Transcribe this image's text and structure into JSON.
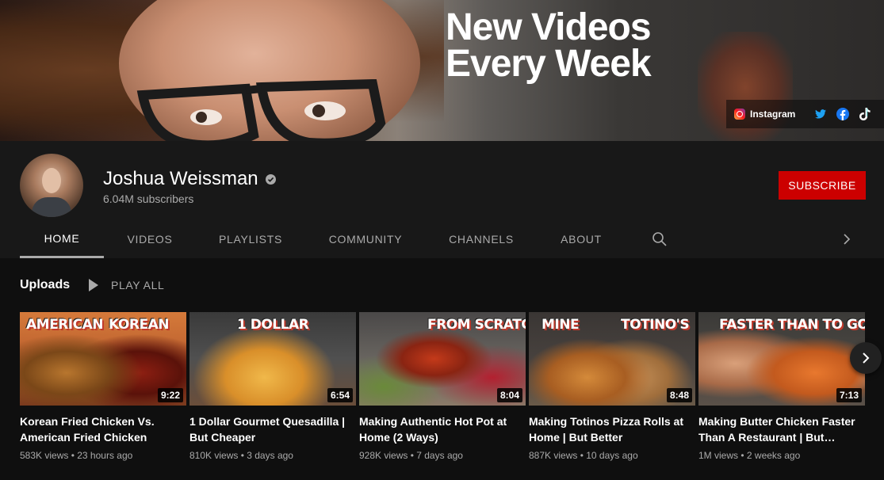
{
  "banner": {
    "title_line1": "New Videos",
    "title_line2": "Every Week",
    "links": {
      "instagram_label": "Instagram",
      "icons": [
        "instagram-icon",
        "twitter-icon",
        "facebook-icon",
        "tiktok-icon"
      ]
    }
  },
  "channel": {
    "name": "Joshua Weissman",
    "subscribers": "6.04M subscribers",
    "subscribe_label": "SUBSCRIBE"
  },
  "tabs": [
    {
      "label": "HOME",
      "active": true
    },
    {
      "label": "VIDEOS",
      "active": false
    },
    {
      "label": "PLAYLISTS",
      "active": false
    },
    {
      "label": "COMMUNITY",
      "active": false
    },
    {
      "label": "CHANNELS",
      "active": false
    },
    {
      "label": "ABOUT",
      "active": false
    }
  ],
  "uploads": {
    "title": "Uploads",
    "play_all_label": "PLAY ALL",
    "videos": [
      {
        "title": "Korean Fried Chicken Vs. American Fried Chicken",
        "duration": "9:22",
        "views": "583K views",
        "age": "23 hours ago",
        "thumb_text_left": "AMERICAN",
        "thumb_text_right": "KOREAN"
      },
      {
        "title": "1 Dollar Gourmet Quesadilla | But Cheaper",
        "duration": "6:54",
        "views": "810K views",
        "age": "3 days ago",
        "thumb_text_left": "1 DOLLAR",
        "thumb_text_right": ""
      },
      {
        "title": "Making Authentic Hot Pot at Home (2 Ways)",
        "duration": "8:04",
        "views": "928K views",
        "age": "7 days ago",
        "thumb_text_left": "",
        "thumb_text_right": "FROM SCRATCH"
      },
      {
        "title": "Making Totinos Pizza Rolls at Home | But Better",
        "duration": "8:48",
        "views": "887K views",
        "age": "10 days ago",
        "thumb_text_left": "MINE",
        "thumb_text_right": "TOTINO'S"
      },
      {
        "title": "Making Butter Chicken Faster Than A Restaurant | But…",
        "duration": "7:13",
        "views": "1M views",
        "age": "2 weeks ago",
        "thumb_text_left": "FASTER THAN TO GO",
        "thumb_text_right": ""
      }
    ]
  },
  "colors": {
    "accent": "#cc0000",
    "background": "#181818",
    "content_bg": "#0f0f0f",
    "muted_text": "#aaaaaa"
  }
}
